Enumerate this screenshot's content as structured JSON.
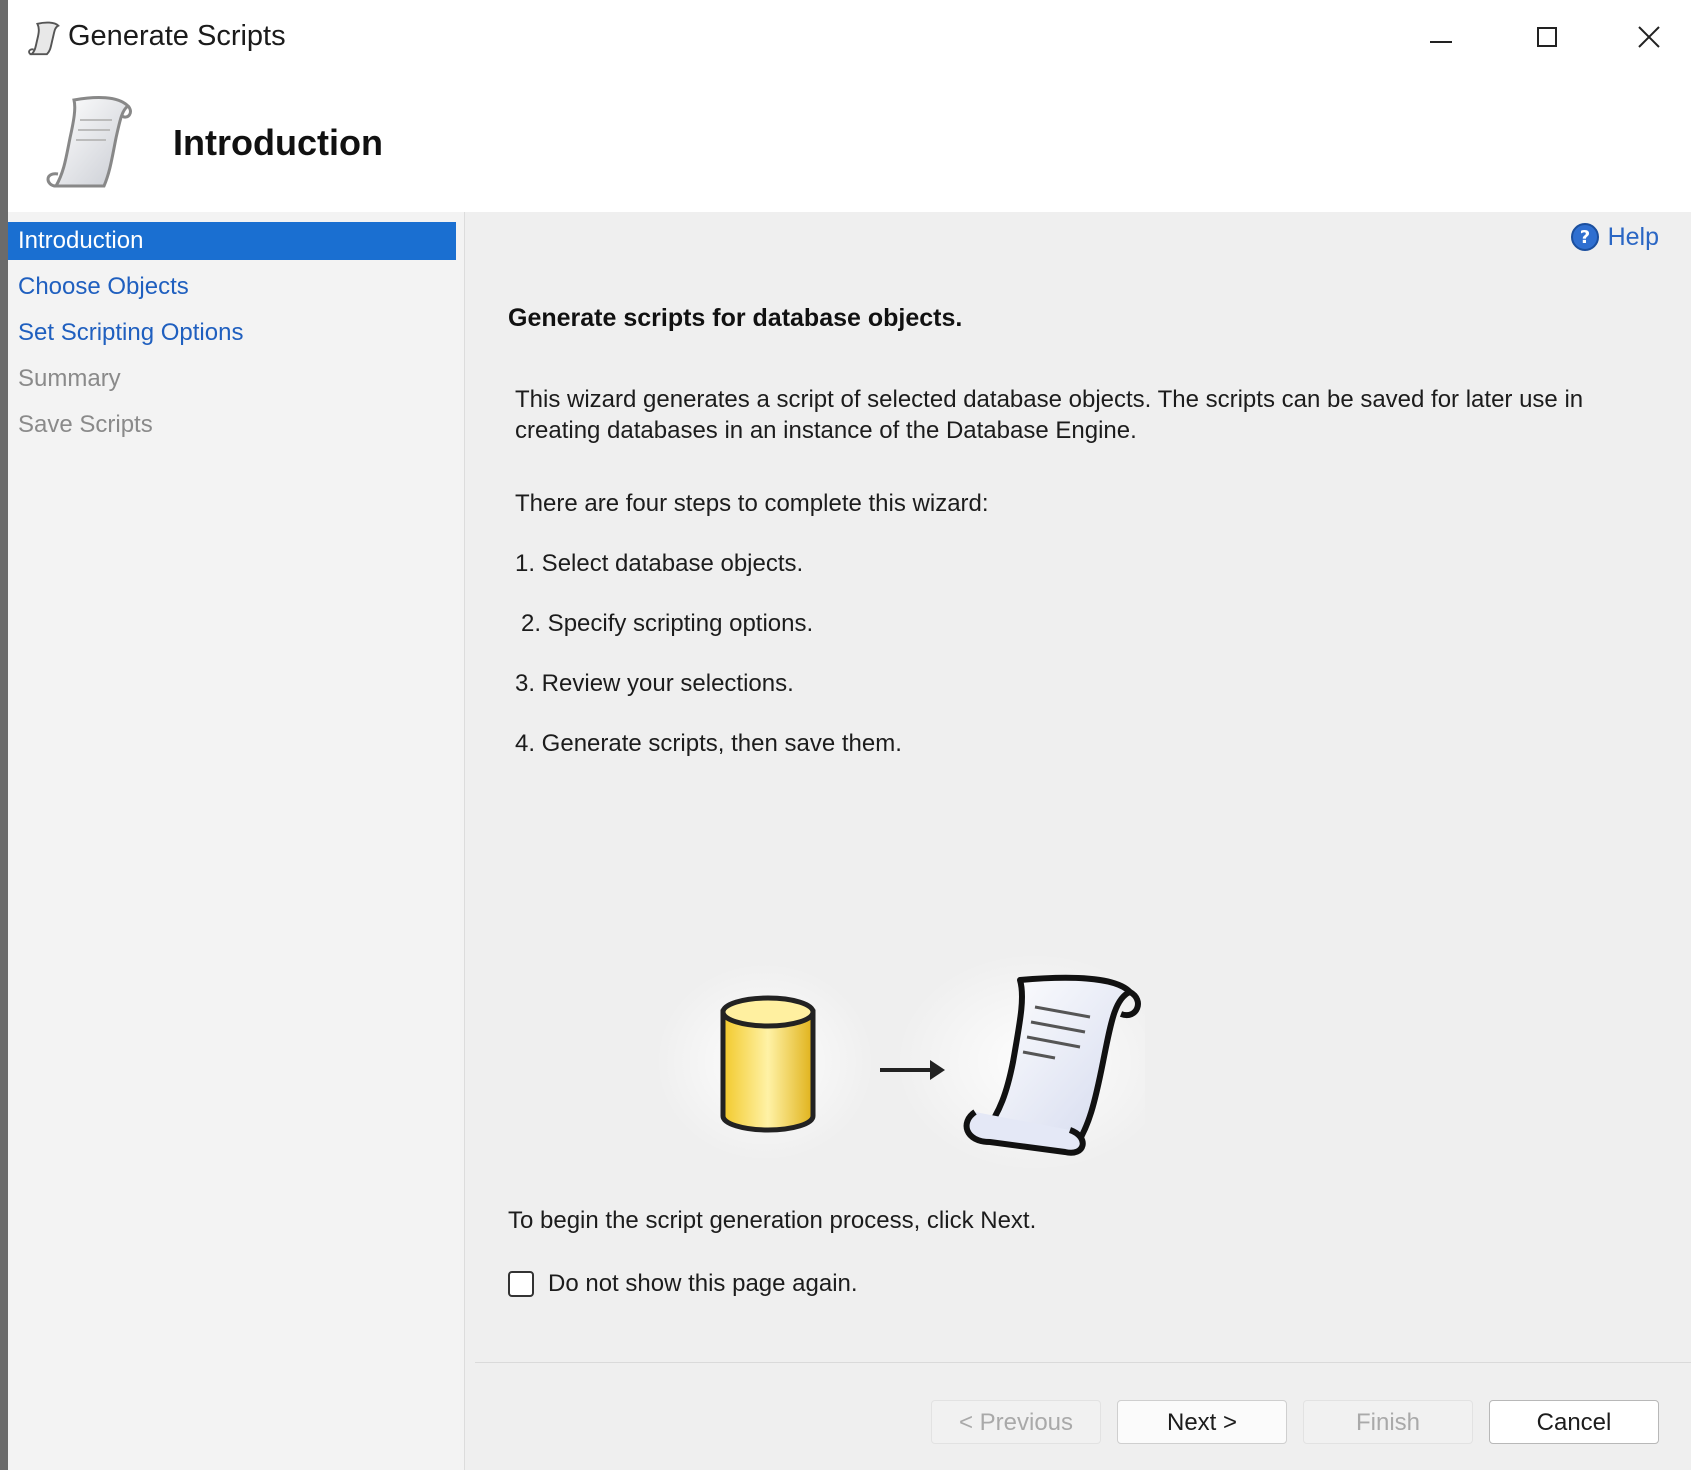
{
  "window": {
    "title": "Generate Scripts",
    "buttons": {
      "minimize": "minimize-icon",
      "maximize": "maximize-icon",
      "close": "close-icon"
    }
  },
  "header": {
    "title": "Introduction",
    "icon": "scroll-icon"
  },
  "nav": {
    "items": [
      {
        "label": "Introduction",
        "state": "active"
      },
      {
        "label": "Choose Objects",
        "state": "link"
      },
      {
        "label": "Set Scripting Options",
        "state": "link"
      },
      {
        "label": "Summary",
        "state": "disabled"
      },
      {
        "label": "Save Scripts",
        "state": "disabled"
      }
    ]
  },
  "content": {
    "help_label": "Help",
    "heading": "Generate scripts for database objects.",
    "description": "This wizard generates a script of selected database objects. The scripts can be saved for later use in creating databases in an instance of the Database Engine.",
    "steps_intro": "There are four steps to complete this wizard:",
    "steps": [
      "1. Select database objects.",
      "2. Specify scripting options.",
      "3. Review your selections.",
      "4. Generate scripts, then save them."
    ],
    "begin_text": "To begin the script generation process, click Next.",
    "checkbox_label": "Do not show this page again.",
    "checkbox_checked": false
  },
  "footer": {
    "previous_label": "< Previous",
    "next_label": "Next >",
    "finish_label": "Finish",
    "cancel_label": "Cancel"
  },
  "colors": {
    "accent": "#1a6fd1",
    "link": "#1f5fbf",
    "disabled": "#8a8a8a",
    "content_bg": "#efefef"
  }
}
